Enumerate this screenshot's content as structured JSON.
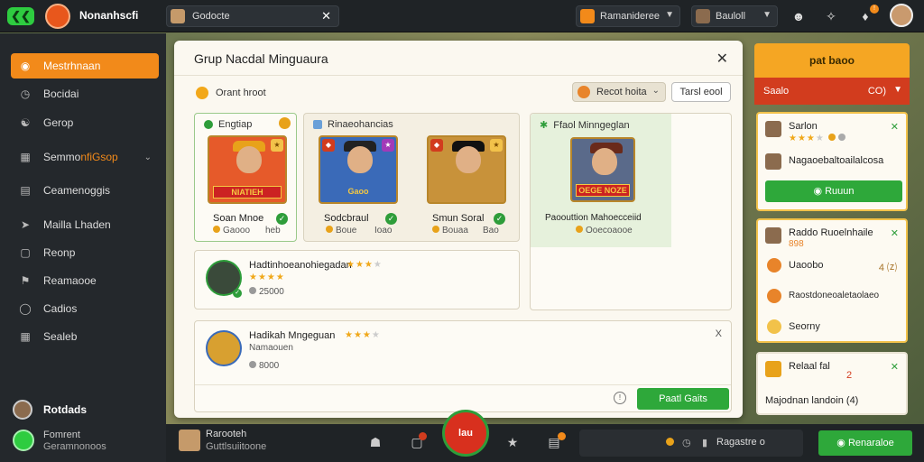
{
  "topbar": {
    "app_title": "Nonanhscfi",
    "search_value": "Godocte",
    "game_select": "Ramanideree",
    "user_select": "Bauloll"
  },
  "sidebar": {
    "items": [
      {
        "label": "Mestrhnaan",
        "icon": "home-icon"
      },
      {
        "label": "Bocidai",
        "icon": "clock-icon"
      },
      {
        "label": "Gerop",
        "icon": "people-icon"
      },
      {
        "label_a": "Semmo ",
        "label_b": "nfiGsop",
        "icon": "grid-icon"
      },
      {
        "label": "Ceamenoggis",
        "icon": "chat-icon"
      },
      {
        "label": "Mailla Lhaden",
        "icon": "sign-icon"
      },
      {
        "label": "Reonp",
        "icon": "box-icon"
      },
      {
        "label": "Reamaooe",
        "icon": "flag-icon"
      },
      {
        "label": "Cadios",
        "icon": "coin-icon"
      },
      {
        "label": "Sealeb",
        "icon": "doc-icon"
      }
    ],
    "footer_user": "Rotdads",
    "footer_line1": "Fomrent",
    "footer_line2": "Geramnonoos"
  },
  "modal": {
    "title": "Grup Nacdal Minguaura",
    "filter_label": "Orant hroot",
    "dropdown": "Recot hoita",
    "outline_button": "Tarsl eool",
    "panel_a_title": "Engtiap",
    "panel_b_title": "Rinaeohancias",
    "panel_c_title": "Ffaol Minngeglan",
    "cards": [
      {
        "name": "Soan Mnoe",
        "sub": "Gaooo",
        "sub2": "heb",
        "banner": "NIATIEH"
      },
      {
        "name": "Sodcbraul",
        "sub": "Boue",
        "sub2": "Ioao",
        "banner": "Gaoo"
      },
      {
        "name": "Smun Soral",
        "sub": "Bouaa",
        "sub2": "Bao",
        "banner": ""
      },
      {
        "name": "Paoouttion Mahoecceiid",
        "sub": "Ooecoaooe",
        "banner": "OEGE NOZE"
      }
    ],
    "row1": {
      "name": "Hadtinhoeanohiegadan",
      "value": "25000"
    },
    "row2": {
      "name": "Hadikah Mngeguan",
      "sub": "Namaouen",
      "value": "8000",
      "close": "X"
    },
    "row2_button": "Paatl Gaits"
  },
  "right_panel": {
    "top_button": "pat baoo",
    "red_left": "Saalo",
    "red_right": "CO)",
    "card1": {
      "name": "Sarlon",
      "line": "Nagaoebaltoailalcosa",
      "button": "Ruuun"
    },
    "card2": {
      "name": "Raddo Ruoelnhaile",
      "sub": "898",
      "i1": "Uaoobo",
      "i2": "Raostdoneoaletaolaeo",
      "i3": "Seorny",
      "i1_right": "4 ⒵"
    },
    "card3": {
      "name": "Relaal fal",
      "num": "2",
      "line": "Majodnan landoin (4)"
    }
  },
  "bottombar": {
    "l1": "Rarooteh",
    "l2": "Guttlsuiitoone",
    "center": "lau",
    "status": "Ragastre o",
    "green_button": "Renaraloe"
  },
  "colors": {
    "accent": "#f28a1a",
    "green": "#2ea83a",
    "red": "#d23c1e"
  }
}
